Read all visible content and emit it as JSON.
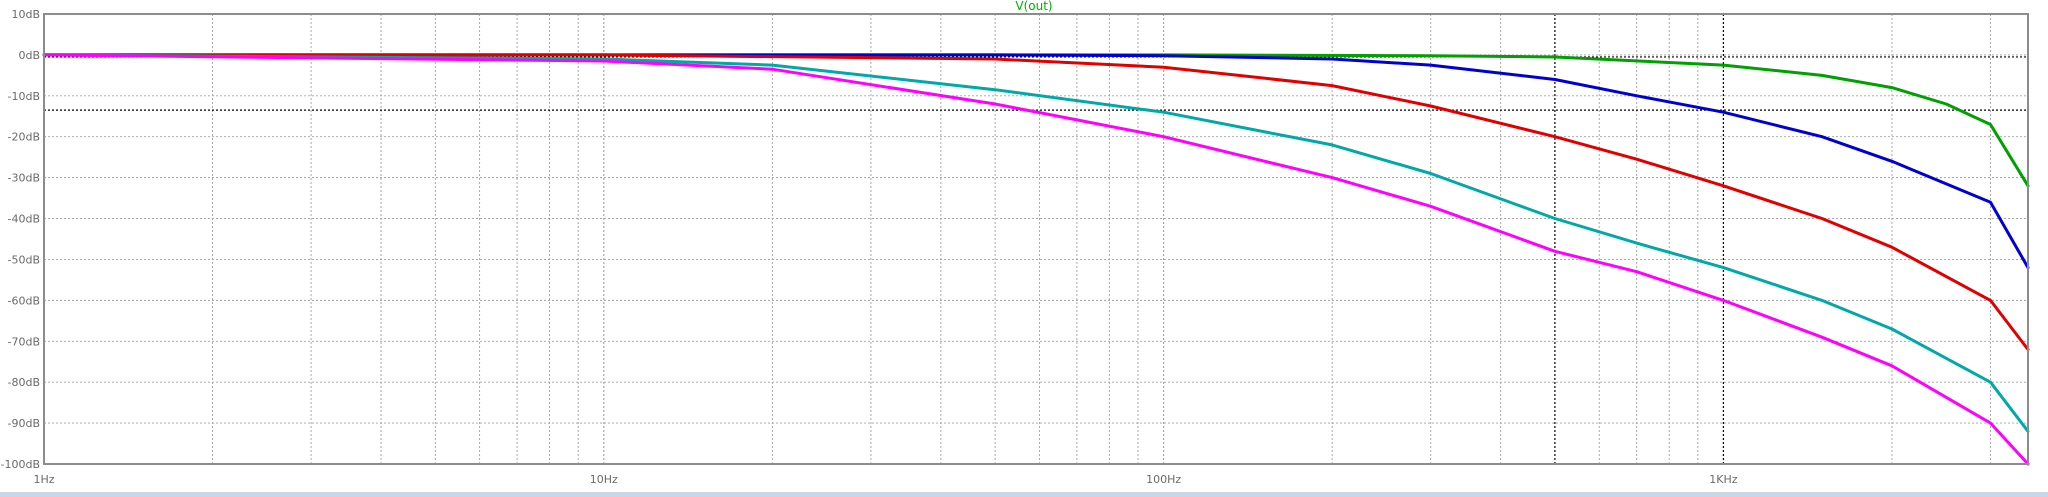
{
  "colors": {
    "grid": "#a0a0a0",
    "axis": "#8c8c8c",
    "cursor": "#000000",
    "title": "#00b000"
  },
  "chart_data": {
    "type": "line",
    "title": "V(out)",
    "xlabel": "",
    "ylabel": "",
    "x_scale": "log",
    "xlim": [
      1,
      3500
    ],
    "ylim": [
      -100,
      10
    ],
    "grid": true,
    "x_ticks": [
      {
        "value": 1,
        "label": "1Hz"
      },
      {
        "value": 10,
        "label": "10Hz"
      },
      {
        "value": 100,
        "label": "100Hz"
      },
      {
        "value": 1000,
        "label": "1KHz"
      }
    ],
    "y_ticks": [
      {
        "value": 10,
        "label": "10dB"
      },
      {
        "value": 0,
        "label": "0dB"
      },
      {
        "value": -10,
        "label": "-10dB"
      },
      {
        "value": -20,
        "label": "-20dB"
      },
      {
        "value": -30,
        "label": "-30dB"
      },
      {
        "value": -40,
        "label": "-40dB"
      },
      {
        "value": -50,
        "label": "-50dB"
      },
      {
        "value": -60,
        "label": "-60dB"
      },
      {
        "value": -70,
        "label": "-70dB"
      },
      {
        "value": -80,
        "label": "-80dB"
      },
      {
        "value": -90,
        "label": "-90dB"
      },
      {
        "value": -100,
        "label": "-100dB"
      }
    ],
    "cursors": {
      "x": [
        500,
        1000
      ],
      "y": [
        -0.5,
        -13.5
      ]
    },
    "series": [
      {
        "color": "#00a000",
        "x": [
          1,
          10,
          100,
          300,
          500,
          1000,
          1500,
          2000,
          2500,
          3000,
          3500
        ],
        "y": [
          0,
          0,
          0,
          -0.2,
          -0.5,
          -2.5,
          -5,
          -8,
          -12,
          -17,
          -32
        ]
      },
      {
        "color": "#0000d0",
        "x": [
          1,
          10,
          50,
          100,
          200,
          300,
          500,
          700,
          1000,
          1500,
          2000,
          3000,
          3500
        ],
        "y": [
          0,
          0,
          0,
          -0.2,
          -1,
          -2.5,
          -6,
          -10,
          -14,
          -20,
          -26,
          -36,
          -52
        ]
      },
      {
        "color": "#e00000",
        "x": [
          1,
          10,
          50,
          100,
          200,
          300,
          500,
          700,
          1000,
          1500,
          2000,
          3000,
          3500
        ],
        "y": [
          0,
          0,
          -1,
          -3,
          -7.5,
          -12.5,
          -20,
          -25.5,
          -32,
          -40,
          -47,
          -60,
          -72
        ]
      },
      {
        "color": "#00a8a8",
        "x": [
          1,
          10,
          20,
          50,
          100,
          200,
          300,
          500,
          700,
          1000,
          1500,
          2000,
          3000,
          3500
        ],
        "y": [
          0,
          -1,
          -2.5,
          -8.5,
          -14,
          -22,
          -29,
          -40,
          -46,
          -52,
          -60,
          -67,
          -80,
          -92
        ]
      },
      {
        "color": "#ff00ff",
        "x": [
          1,
          10,
          20,
          50,
          100,
          200,
          300,
          500,
          700,
          1000,
          1500,
          2000,
          3000,
          3500
        ],
        "y": [
          0,
          -1.5,
          -3.5,
          -12,
          -20,
          -30,
          -37,
          -48,
          -53,
          -60,
          -69,
          -76,
          -90,
          -100
        ]
      }
    ]
  }
}
